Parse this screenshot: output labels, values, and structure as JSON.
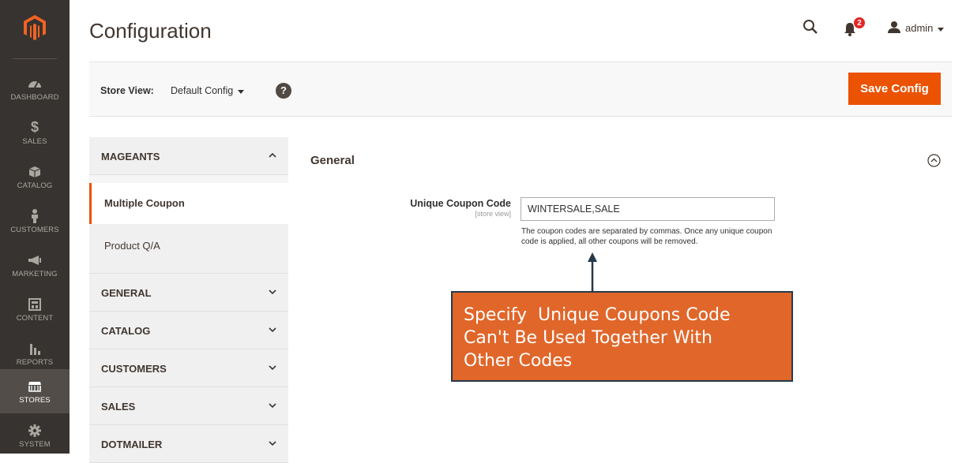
{
  "admin_menu": {
    "items": [
      {
        "label": "DASHBOARD",
        "icon": "dashboard-icon"
      },
      {
        "label": "SALES",
        "icon": "dollar-icon"
      },
      {
        "label": "CATALOG",
        "icon": "box-icon"
      },
      {
        "label": "CUSTOMERS",
        "icon": "person-icon"
      },
      {
        "label": "MARKETING",
        "icon": "megaphone-icon"
      },
      {
        "label": "CONTENT",
        "icon": "content-icon"
      },
      {
        "label": "REPORTS",
        "icon": "bar-chart-icon"
      },
      {
        "label": "STORES",
        "icon": "store-icon",
        "active": true
      },
      {
        "label": "SYSTEM",
        "icon": "gear-icon"
      }
    ]
  },
  "header": {
    "title": "Configuration",
    "notification_count": "2",
    "user": "admin"
  },
  "store_bar": {
    "label": "Store View:",
    "selected": "Default Config",
    "help": "?",
    "save_label": "Save Config"
  },
  "tabs": {
    "groups": [
      {
        "label": "MAGEANTS",
        "expanded": true,
        "items": [
          "Multiple Coupon",
          "Product Q/A"
        ],
        "active_item": "Multiple Coupon"
      },
      {
        "label": "GENERAL",
        "expanded": false
      },
      {
        "label": "CATALOG",
        "expanded": false
      },
      {
        "label": "CUSTOMERS",
        "expanded": false
      },
      {
        "label": "SALES",
        "expanded": false
      },
      {
        "label": "DOTMAILER",
        "expanded": false
      }
    ]
  },
  "section": {
    "title": "General",
    "field": {
      "label": "Unique Coupon Code",
      "scope": "[store view]",
      "value": "WINTERSALE,SALE",
      "note": "The coupon codes are separated by commas. Once any unique coupon code is applied, all other coupons will be removed."
    }
  },
  "annotation": {
    "lines": [
      "Specify  Unique Coupons Code",
      "Can't Be Used Together With",
      "Other Codes"
    ]
  },
  "colors": {
    "menu_bg": "#373330",
    "accent": "#eb5202",
    "callout_bg": "#e0662a",
    "callout_border": "#25394a"
  }
}
